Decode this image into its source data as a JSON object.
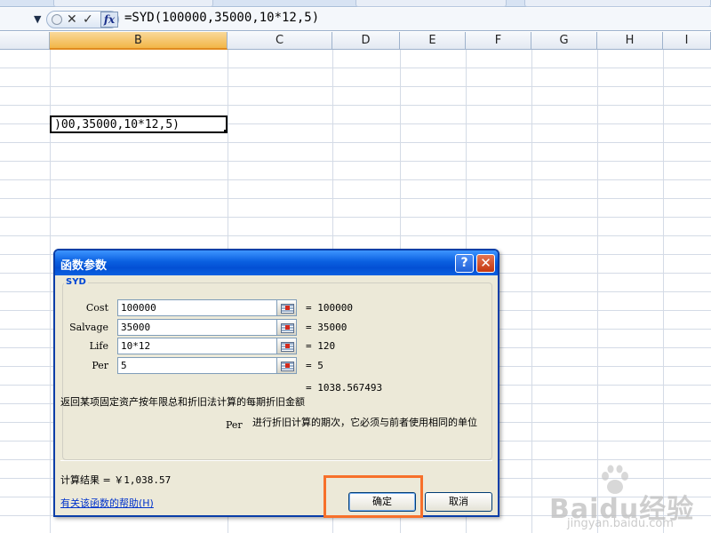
{
  "formula_bar": {
    "formula": "=SYD(100000,35000,10*12,5)",
    "fx_label": "fx"
  },
  "columns": [
    "B",
    "C",
    "D",
    "E",
    "F",
    "G",
    "H",
    "I"
  ],
  "active_cell": {
    "display": ")00,35000,10*12,5)"
  },
  "dialog": {
    "title": "函数参数",
    "function_name": "SYD",
    "arguments": [
      {
        "label": "Cost",
        "value": "100000",
        "evaluated": "= 100000"
      },
      {
        "label": "Salvage",
        "value": "35000",
        "evaluated": "= 35000"
      },
      {
        "label": "Life",
        "value": "10*12",
        "evaluated": "= 120"
      },
      {
        "label": "Per",
        "value": "5",
        "evaluated": "= 5"
      }
    ],
    "formula_result_value": "= 1038.567493",
    "description": "返回某项固定资产按年限总和折旧法计算的每期折旧金额",
    "arg_help_name": "Per",
    "arg_help_text": "进行折旧计算的期次，它必须与前者使用相同的单位",
    "result_label": "计算结果 =",
    "result_value": "￥1,038.57",
    "help_link": "有关该函数的帮助(H)",
    "ok_label": "确定",
    "cancel_label": "取消",
    "help_btn": "?",
    "close_btn": "✕"
  },
  "watermark": {
    "line1": "Baidu经验",
    "line2": "jingyan.baidu.com"
  },
  "colors": {
    "title_bar": "#0a5fe0",
    "selected_column": "#f2b648",
    "highlight_box": "#f7702a"
  }
}
